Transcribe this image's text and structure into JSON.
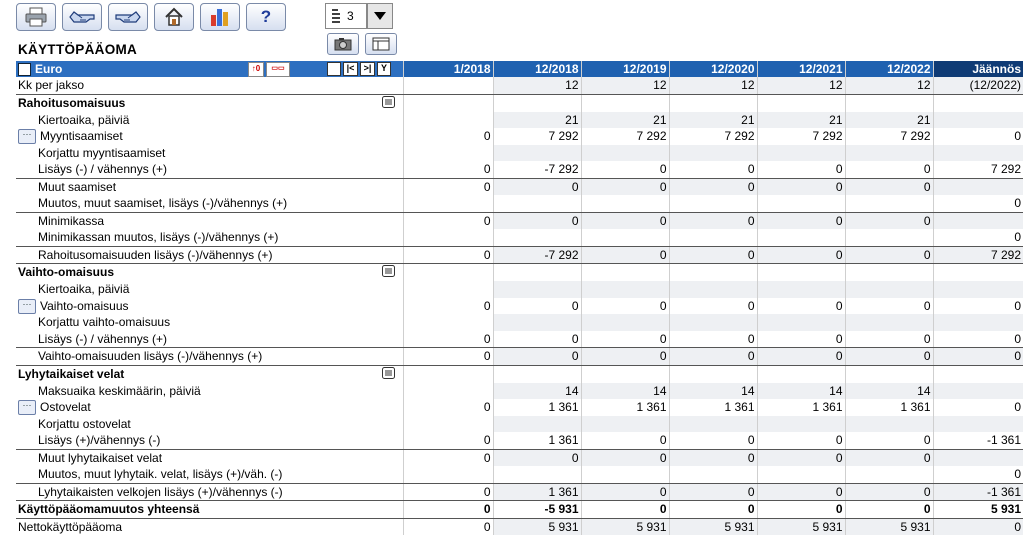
{
  "toolbar": {
    "buttons": [
      {
        "name": "print-button",
        "icon": "printer-icon"
      },
      {
        "name": "back-button",
        "icon": "hand-back-icon"
      },
      {
        "name": "forward-button",
        "icon": "hand-forward-icon"
      },
      {
        "name": "home-button",
        "icon": "home-icon"
      },
      {
        "name": "chart-button",
        "icon": "bar-chart-icon"
      },
      {
        "name": "help-button",
        "icon": "help-icon",
        "label": "?"
      }
    ],
    "period_select_value": "3"
  },
  "page_title": "KÄYTTÖPÄÄOMA",
  "table": {
    "corner_label": "Euro",
    "columns": [
      "1/2018",
      "12/2018",
      "12/2019",
      "12/2020",
      "12/2021",
      "12/2022",
      "Jäännös"
    ],
    "rows": [
      {
        "label": "Kk per jakso",
        "type": "plain",
        "vals": [
          "",
          "12",
          "12",
          "12",
          "12",
          "12",
          "(12/2022)"
        ]
      },
      {
        "label": "Rahoitusomaisuus",
        "type": "section",
        "vals": [
          "",
          "",
          "",
          "",
          "",
          "",
          ""
        ]
      },
      {
        "label": "Kiertoaika, päiviä",
        "type": "indent",
        "vals": [
          "",
          "21",
          "21",
          "21",
          "21",
          "21",
          ""
        ]
      },
      {
        "label": "Myyntisaamiset",
        "type": "more",
        "vals": [
          "0",
          "7 292",
          "7 292",
          "7 292",
          "7 292",
          "7 292",
          "0"
        ]
      },
      {
        "label": "Korjattu myyntisaamiset",
        "type": "indent",
        "vals": [
          "",
          "",
          "",
          "",
          "",
          "",
          ""
        ]
      },
      {
        "label": "Lisäys (-) / vähennys (+)",
        "type": "indent-line",
        "vals": [
          "0",
          "-7 292",
          "0",
          "0",
          "0",
          "0",
          "7 292"
        ]
      },
      {
        "label": "Muut saamiset",
        "type": "indent",
        "vals": [
          "0",
          "0",
          "0",
          "0",
          "0",
          "0",
          ""
        ]
      },
      {
        "label": "Muutos, muut saamiset, lisäys (-)/vähennys (+)",
        "type": "indent-line",
        "vals": [
          "",
          "",
          "",
          "",
          "",
          "",
          "0"
        ]
      },
      {
        "label": "Minimikassa",
        "type": "indent",
        "vals": [
          "0",
          "0",
          "0",
          "0",
          "0",
          "0",
          ""
        ]
      },
      {
        "label": "Minimikassan muutos, lisäys (-)/vähennys (+)",
        "type": "indent-line",
        "vals": [
          "",
          "",
          "",
          "",
          "",
          "",
          "0"
        ]
      },
      {
        "label": "Rahoitusomaisuuden lisäys (-)/vähennys (+)",
        "type": "indent-line",
        "vals": [
          "0",
          "-7 292",
          "0",
          "0",
          "0",
          "0",
          "7 292"
        ]
      },
      {
        "label": "Vaihto-omaisuus",
        "type": "section",
        "vals": [
          "",
          "",
          "",
          "",
          "",
          "",
          ""
        ]
      },
      {
        "label": "Kiertoaika, päiviä",
        "type": "indent",
        "vals": [
          "",
          "",
          "",
          "",
          "",
          "",
          ""
        ]
      },
      {
        "label": "Vaihto-omaisuus",
        "type": "more",
        "vals": [
          "0",
          "0",
          "0",
          "0",
          "0",
          "0",
          "0"
        ]
      },
      {
        "label": "Korjattu vaihto-omaisuus",
        "type": "indent",
        "vals": [
          "",
          "",
          "",
          "",
          "",
          "",
          ""
        ]
      },
      {
        "label": "Lisäys (-) / vähennys (+)",
        "type": "indent-line",
        "vals": [
          "0",
          "0",
          "0",
          "0",
          "0",
          "0",
          "0"
        ]
      },
      {
        "label": "Vaihto-omaisuuden lisäys (-)/vähennys (+)",
        "type": "indent-line",
        "vals": [
          "0",
          "0",
          "0",
          "0",
          "0",
          "0",
          "0"
        ]
      },
      {
        "label": "Lyhytaikaiset velat",
        "type": "section",
        "vals": [
          "",
          "",
          "",
          "",
          "",
          "",
          ""
        ]
      },
      {
        "label": "Maksuaika keskimäärin, päiviä",
        "type": "indent",
        "vals": [
          "",
          "14",
          "14",
          "14",
          "14",
          "14",
          ""
        ]
      },
      {
        "label": "Ostovelat",
        "type": "more",
        "vals": [
          "0",
          "1 361",
          "1 361",
          "1 361",
          "1 361",
          "1 361",
          "0"
        ]
      },
      {
        "label": "Korjattu ostovelat",
        "type": "indent",
        "vals": [
          "",
          "",
          "",
          "",
          "",
          "",
          ""
        ]
      },
      {
        "label": "Lisäys (+)/vähennys (-)",
        "type": "indent-line",
        "vals": [
          "0",
          "1 361",
          "0",
          "0",
          "0",
          "0",
          "-1 361"
        ]
      },
      {
        "label": "Muut lyhytaikaiset velat",
        "type": "indent",
        "vals": [
          "0",
          "0",
          "0",
          "0",
          "0",
          "0",
          ""
        ]
      },
      {
        "label": "Muutos, muut lyhytaik. velat, lisäys (+)/väh. (-)",
        "type": "indent-line",
        "vals": [
          "",
          "",
          "",
          "",
          "",
          "",
          "0"
        ]
      },
      {
        "label": "Lyhytaikaisten velkojen lisäys (+)/vähennys (-)",
        "type": "indent-line",
        "vals": [
          "0",
          "1 361",
          "0",
          "0",
          "0",
          "0",
          "-1 361"
        ]
      },
      {
        "label": "Käyttöpääomamuutos yhteensä",
        "type": "total",
        "vals": [
          "0",
          "-5 931",
          "0",
          "0",
          "0",
          "0",
          "5 931"
        ]
      },
      {
        "label": "Nettokäyttöpääoma",
        "type": "plain",
        "vals": [
          "0",
          "5 931",
          "5 931",
          "5 931",
          "5 931",
          "5 931",
          "0"
        ]
      }
    ]
  },
  "colors": {
    "header_bg": "#1f61b0",
    "header_last_bg": "#0f3b75",
    "shade": "#eef0f3"
  }
}
